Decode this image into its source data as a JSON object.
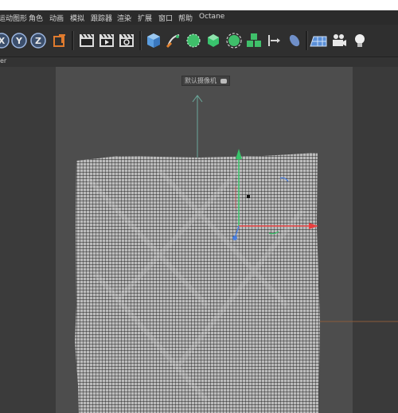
{
  "menubar": {
    "items": [
      "运动图形",
      "角色",
      "动画",
      "模拟",
      "跟踪器",
      "渲染",
      "扩展",
      "窗口",
      "帮助",
      "Octane"
    ]
  },
  "toolbar": {
    "axis_x": "X",
    "axis_y": "Y",
    "axis_z": "Z",
    "icons": [
      "lock-axis-x-icon",
      "lock-axis-y-icon",
      "lock-axis-z-icon",
      "coordinate-system-icon",
      "render-view-icon",
      "render-to-picture-viewer-icon",
      "render-settings-icon",
      "cube-icon",
      "pen-icon",
      "subdivision-icon",
      "generator-icon",
      "deformer-icon",
      "array-icon",
      "spline-icon",
      "environment-icon",
      "floor-icon",
      "camera-icon",
      "light-icon"
    ]
  },
  "subbar": {
    "label": "er"
  },
  "viewport": {
    "camera_label": "默认摄像机",
    "camera_icon": "camera-badge-icon",
    "colors": {
      "axis_x": "#e84040",
      "axis_y": "#38c46a",
      "axis_z": "#4a7fe0",
      "mesh": "#b4b4b4",
      "world_axis": "#6aa89a"
    }
  }
}
